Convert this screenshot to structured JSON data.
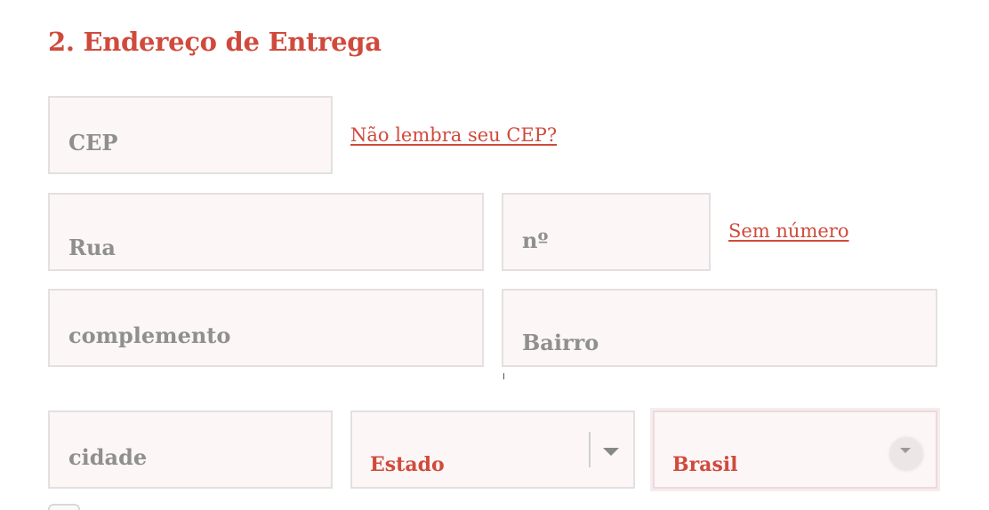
{
  "section": {
    "title": "2. Endereço de Entrega"
  },
  "fields": {
    "cep": {
      "placeholder": "CEP"
    },
    "rua": {
      "placeholder": "Rua"
    },
    "numero": {
      "placeholder": "nº"
    },
    "complemento": {
      "placeholder": "complemento"
    },
    "bairro": {
      "placeholder": "Bairro"
    },
    "cidade": {
      "placeholder": "cidade"
    }
  },
  "links": {
    "forgot_cep": "Não lembra seu CEP?",
    "no_number": "Sem número"
  },
  "selects": {
    "estado": {
      "value": "Estado",
      "icon": "chevron-down-icon"
    },
    "pais": {
      "value": "Brasil",
      "icon": "chevron-down-icon"
    }
  },
  "colors": {
    "accent": "#d04a3c",
    "field_bg": "#fcf6f6",
    "field_border": "#e4e0e0",
    "placeholder": "#8f8f8f"
  }
}
